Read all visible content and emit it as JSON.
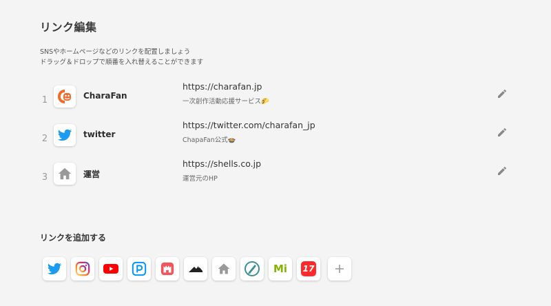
{
  "page": {
    "title": "リンク編集",
    "description_line1": "SNSやホームページなどのリンクを配置しましょう",
    "description_line2": "ドラッグ＆ドロップで順番を入れ替えることができます"
  },
  "links": [
    {
      "number": "1",
      "name": "CharaFan",
      "url": "https://charafan.jp",
      "subtitle": "一次創作活動応援サービス",
      "icon": "charafan-icon"
    },
    {
      "number": "2",
      "name": "twitter",
      "url": "https://twitter.com/charafan_jp",
      "subtitle": "ChараFan公式",
      "icon": "twitter-bird-icon"
    },
    {
      "number": "3",
      "name": "運営",
      "url": "https://shells.co.jp",
      "subtitle": "運営元のHP",
      "icon": "home-icon"
    }
  ],
  "add_section": {
    "title": "リンクを追加する",
    "services": [
      "twitter-icon",
      "instagram-icon",
      "youtube-icon",
      "pixiv-icon",
      "castle-icon",
      "mountain-icon",
      "home-icon",
      "pen-icon",
      "mi-icon",
      "seventeen-icon",
      "plus-icon"
    ],
    "mi_label": "Mi",
    "seventeen_label": "17"
  },
  "colors": {
    "charafan_orange": "#f26b2a",
    "twitter_blue": "#1d9bf0",
    "youtube_red": "#ff0000",
    "pixiv_blue": "#0096fa",
    "castle_red": "#f2545b",
    "mi_green": "#86b300",
    "seventeen_red": "#ff2a2a",
    "pen_teal": "#3a8f95"
  }
}
